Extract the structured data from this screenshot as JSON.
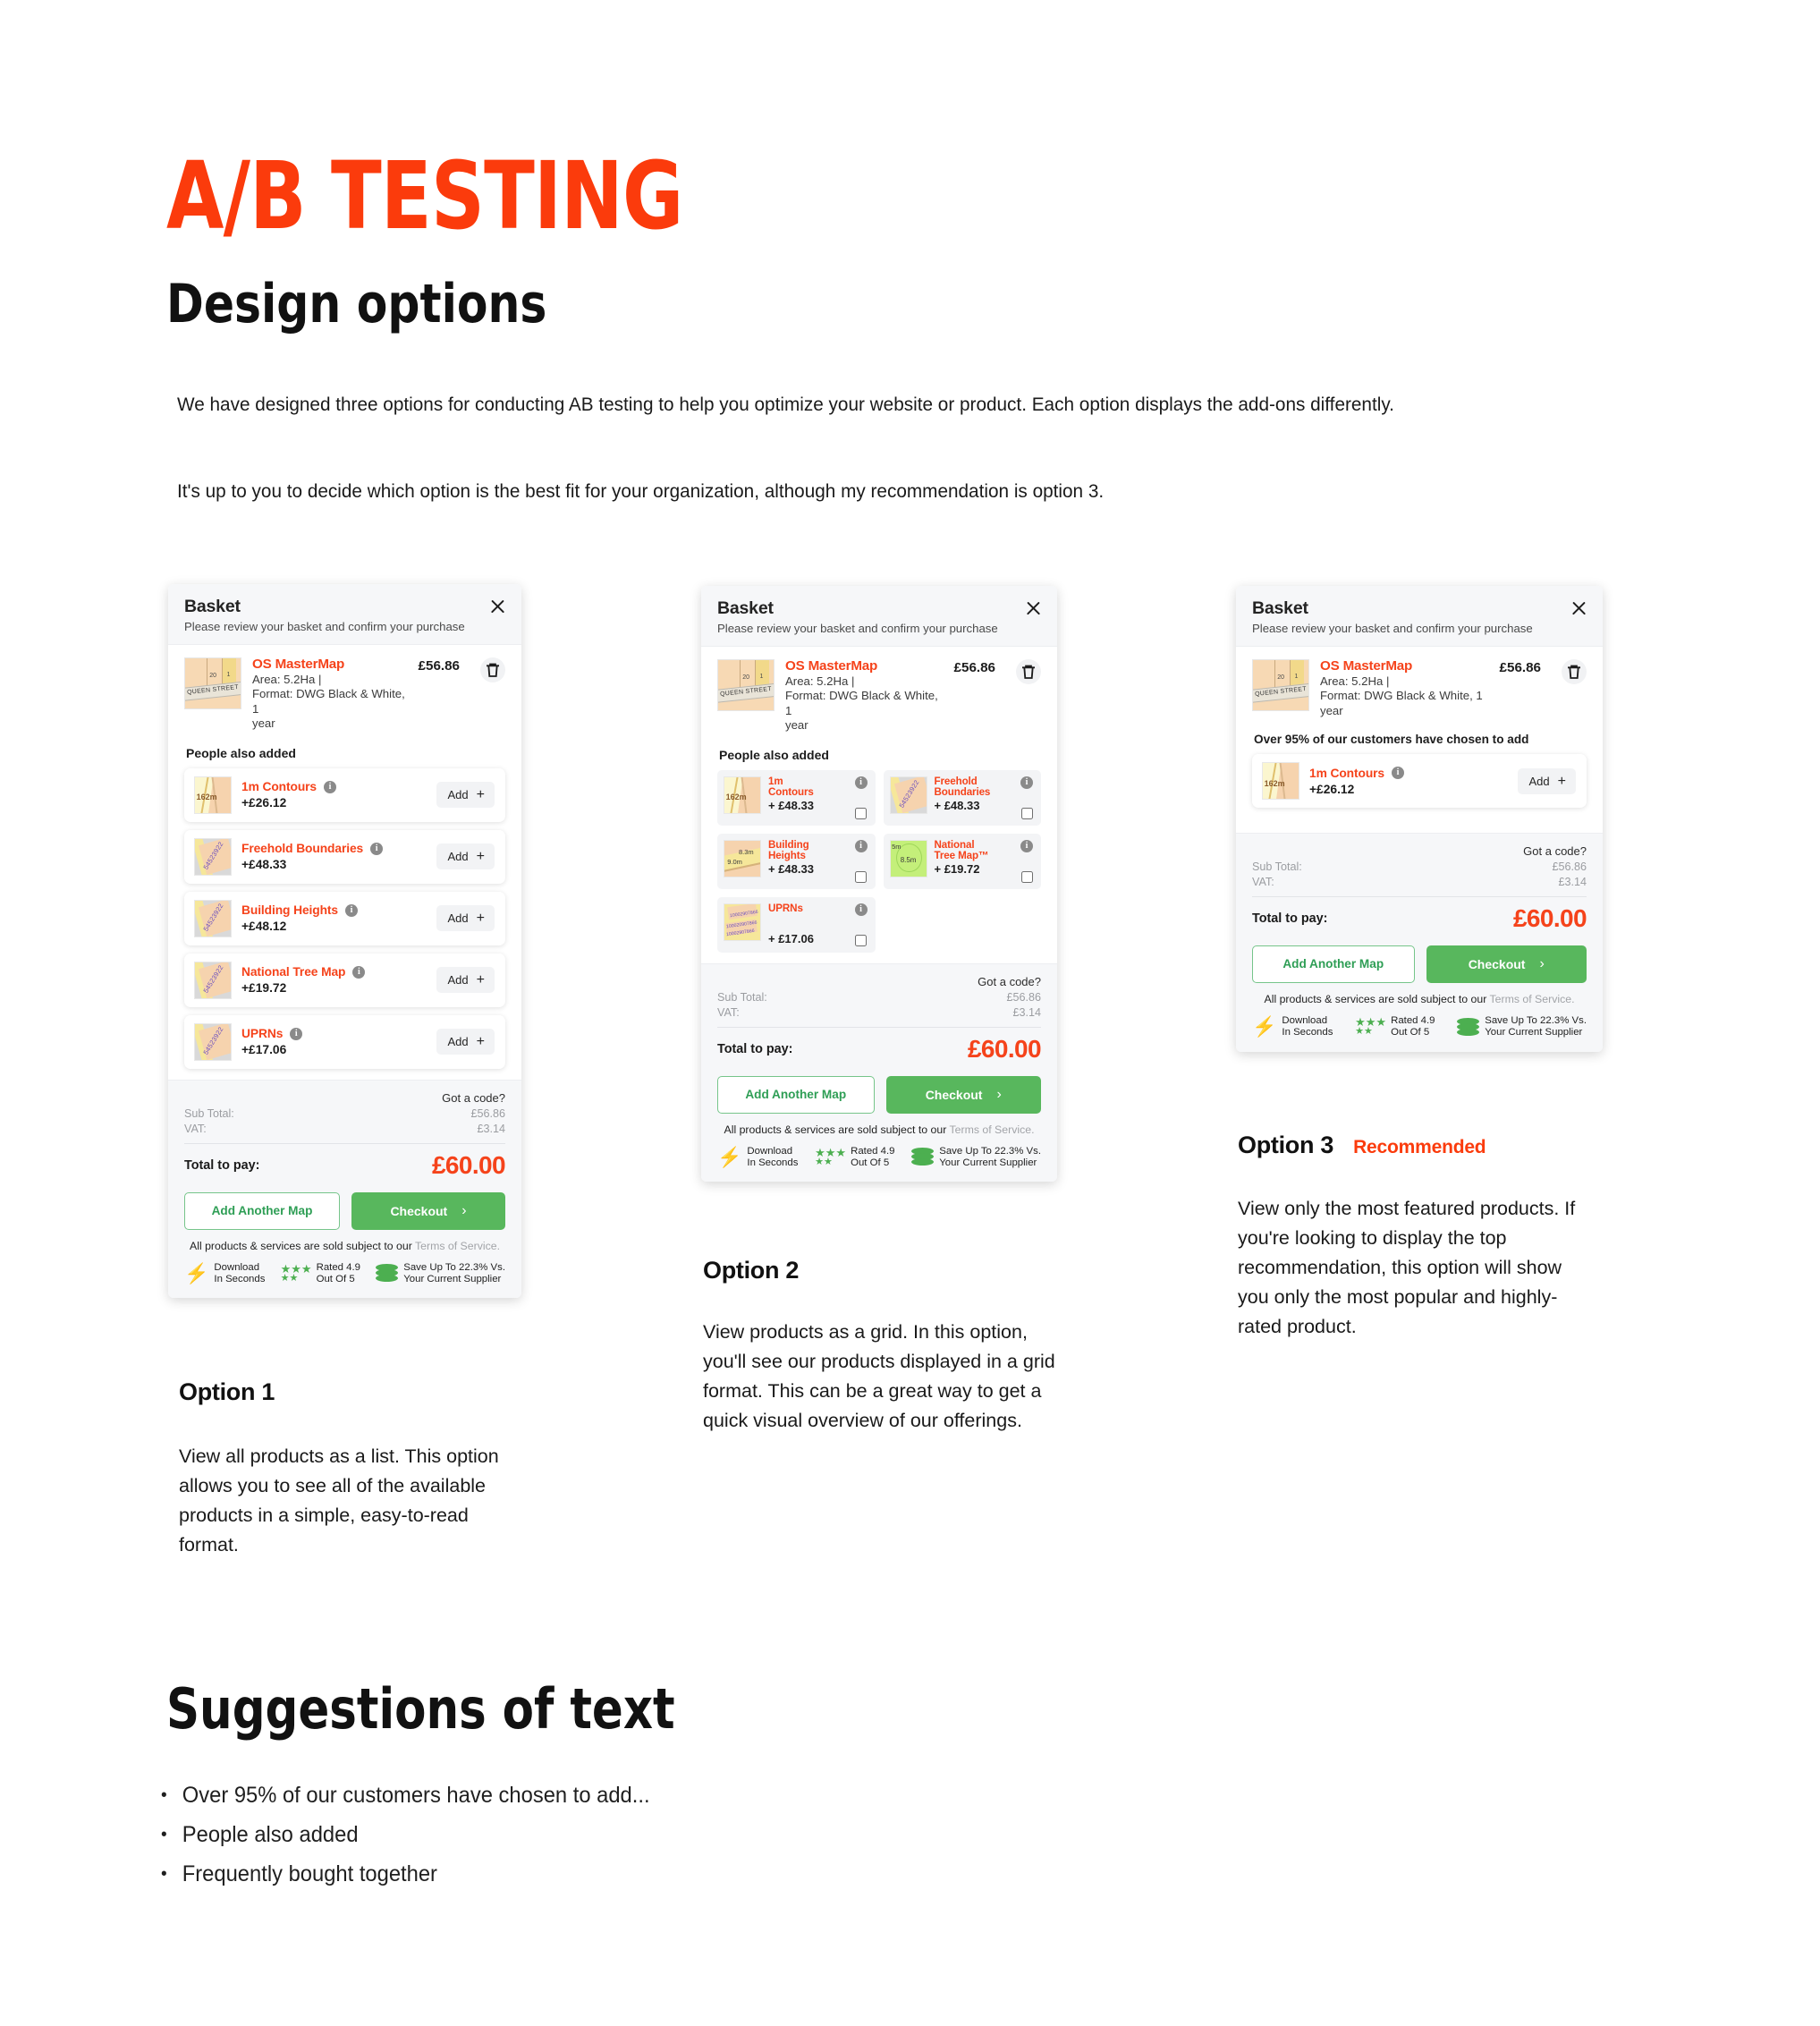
{
  "headings": {
    "main_title": "A/B TESTING",
    "subtitle": "Design options",
    "intro_1": "We have designed three options for conducting AB testing to help you optimize your website or product. Each option displays the add-ons differently.",
    "intro_2": "It's up to you to decide which option is the best fit for your organization, although my recommendation is option 3.",
    "suggestions_title": "Suggestions of text"
  },
  "colors": {
    "accent_orange": "#FB3B0C",
    "product_orange": "#F5431B",
    "button_green": "#58B75D",
    "outline_green": "#2E9E55",
    "card_grey": "#f6f7f9"
  },
  "basket": {
    "title": "Basket",
    "subtitle": "Please review your basket and confirm your purchase",
    "close_icon": "close-icon",
    "delete_icon": "trash-icon",
    "main_item": {
      "name": "OS MasterMap",
      "meta_line1": "Area: 5.2Ha  |",
      "meta_line2": "Format: DWG Black & White, 1",
      "meta_line3": "year",
      "price": "£56.86",
      "thumb_label": "QUEEN STREET",
      "thumb_num1": "20",
      "thumb_num2": "1"
    }
  },
  "totals": {
    "got_a_code": "Got a code?",
    "sub_total_label": "Sub Total:",
    "sub_total_value": "£56.86",
    "vat_label": "VAT:",
    "vat_value": "£3.14",
    "total_label": "Total to pay:",
    "total_value": "£60.00",
    "add_another_map": "Add Another Map",
    "checkout": "Checkout",
    "checkout_chevron": "chevron-right-icon",
    "tos_prefix": "All products & services are sold subject to our ",
    "tos_link": "Terms of Service.",
    "trust": [
      {
        "icon": "lightning-bolt-icon",
        "line1": "Download",
        "line2": "In Seconds"
      },
      {
        "icon": "stars-icon",
        "line1": "Rated 4.9",
        "line2": "Out Of 5"
      },
      {
        "icon": "coins-icon",
        "line1": "Save Up To 22.3% Vs.",
        "line2": "Your Current Supplier"
      }
    ]
  },
  "option1": {
    "section_label": "People also added",
    "add_label": "Add",
    "info_icon": "info-icon",
    "items": [
      {
        "name": "1m Contours",
        "price": "+£26.12",
        "thumb_label": "162m"
      },
      {
        "name": "Freehold Boundaries",
        "price": "+£48.33",
        "thumb_label": "54523922"
      },
      {
        "name": "Building Heights",
        "price": "+£48.12",
        "thumb_label": "54523922"
      },
      {
        "name": "National Tree Map",
        "price": "+£19.72",
        "thumb_label": "54523922"
      },
      {
        "name": "UPRNs",
        "price": "+£17.06",
        "thumb_label": "54523922"
      }
    ],
    "caption_title": "Option 1",
    "caption_desc": "View all products as a list. This option allows you to see all of the available products in a simple, easy-to-read format."
  },
  "option2": {
    "section_label": "People also added",
    "info_icon": "info-icon",
    "checkbox_icon": "checkbox-unchecked-icon",
    "items": [
      {
        "name_line1": "1m",
        "name_line2": "Contours",
        "price": "+ £48.33",
        "thumb_label": "162m"
      },
      {
        "name_line1": "Freehold",
        "name_line2": "Boundaries",
        "price": "+ £48.33",
        "thumb_label": "54523922"
      },
      {
        "name_line1": "Building",
        "name_line2": "Heights",
        "price": "+ £48.33",
        "thumb_label": "8.3m"
      },
      {
        "name_line1": "National",
        "name_line2": "Tree Map™",
        "price": "+ £19.72",
        "thumb_label": "8.5m"
      },
      {
        "name_line1": "UPRNs",
        "name_line2": "",
        "price": "+ £17.06",
        "thumb_label": "10002907866"
      }
    ],
    "caption_title": "Option 2",
    "caption_desc": "View products as a grid. In this option, you'll see our products displayed in a grid format. This can be a great way to get a quick visual overview of our offerings."
  },
  "option3": {
    "section_label": "Over 95% of our customers have chosen to add",
    "add_label": "Add",
    "info_icon": "info-icon",
    "items": [
      {
        "name": "1m Contours",
        "price": "+£26.12",
        "thumb_label": "162m"
      }
    ],
    "caption_title": "Option 3",
    "caption_badge": "Recommended",
    "caption_desc": "View only the most featured products. If you're looking to display the top recommendation, this option will show you only the most popular and highly-rated product."
  },
  "suggestions": [
    "Over 95% of our customers have chosen to add...",
    "People also added",
    "Frequently bought together"
  ]
}
